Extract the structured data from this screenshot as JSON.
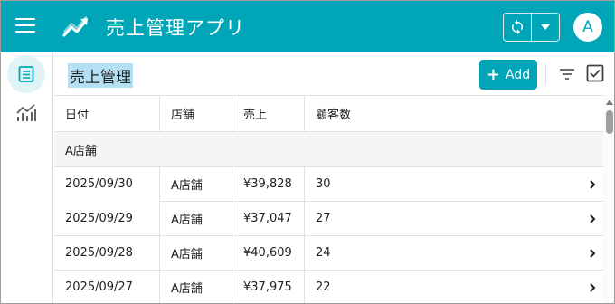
{
  "app": {
    "title": "売上管理アプリ",
    "avatar_initial": "A",
    "accent_color": "#00a6b8"
  },
  "icons": {
    "menu": "hamburger-icon",
    "logo": "trending-up-icon",
    "sync": "sync-icon",
    "sync_menu": "caret-down-icon",
    "rail_list": "list-icon",
    "rail_chart": "line-chart-icon",
    "filter": "filter-icon",
    "select": "checkbox-icon",
    "row_arrow": "chevron-right-icon"
  },
  "toolbar": {
    "page_title": "売上管理",
    "add_label": "Add",
    "add_icon": "+"
  },
  "table": {
    "columns": [
      "日付",
      "店舗",
      "売上",
      "顧客数"
    ],
    "group_label": "A店舗",
    "rows": [
      {
        "date": "2025/09/30",
        "store": "A店舗",
        "sales": "¥39,828",
        "customers": "30"
      },
      {
        "date": "2025/09/29",
        "store": "A店舗",
        "sales": "¥37,047",
        "customers": "27"
      },
      {
        "date": "2025/09/28",
        "store": "A店舗",
        "sales": "¥40,609",
        "customers": "24"
      },
      {
        "date": "2025/09/27",
        "store": "A店舗",
        "sales": "¥37,975",
        "customers": "22"
      }
    ]
  }
}
